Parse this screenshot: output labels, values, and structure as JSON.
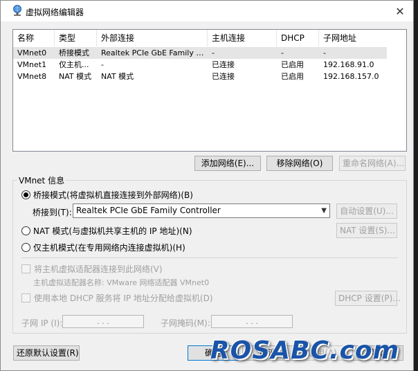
{
  "window": {
    "title": "虚拟网络编辑器",
    "close_glyph": "✕"
  },
  "network_list": {
    "columns": [
      "名称",
      "类型",
      "外部连接",
      "主机连接",
      "DHCP",
      "子网地址"
    ],
    "rows": [
      {
        "name": "VMnet0",
        "type": "桥接模式",
        "external": "Realtek PCIe GbE Family Co...",
        "host": "-",
        "dhcp": "-",
        "subnet": "-",
        "selected": true
      },
      {
        "name": "VMnet1",
        "type": "仅主机...",
        "external": "-",
        "host": "已连接",
        "dhcp": "已启用",
        "subnet": "192.168.91.0",
        "selected": false
      },
      {
        "name": "VMnet8",
        "type": "NAT 模式",
        "external": "NAT 模式",
        "host": "已连接",
        "dhcp": "已启用",
        "subnet": "192.168.157.0",
        "selected": false
      }
    ]
  },
  "list_buttons": {
    "add": "添加网络(E)...",
    "remove": "移除网络(O)",
    "rename": "重命名网络(A)..."
  },
  "vmnet_info": {
    "group_label": "VMnet 信息",
    "bridged_radio": "桥接模式(将虚拟机直接连接到外部网络)(B)",
    "bridged_to_label": "桥接到(T):",
    "bridged_to_value": "Realtek PCIe GbE Family Controller",
    "auto_settings": "自动设置(U)...",
    "nat_radio": "NAT 模式(与虚拟机共享主机的 IP 地址)(N)",
    "nat_settings": "NAT 设置(S)...",
    "hostonly_radio": "仅主机模式(在专用网络内连接虚拟机)(H)",
    "connect_adapter": "将主机虚拟适配器连接到此网络(V)",
    "adapter_name": "主机虚拟适配器名称: VMware 网络适配器 VMnet0",
    "use_dhcp": "使用本地 DHCP 服务将 IP 地址分配给虚拟机(D)",
    "dhcp_settings": "DHCP 设置(P)...",
    "subnet_ip_label": "子网 IP (I):",
    "subnet_mask_label": "子网掩码(M):",
    "ip_dots": ". . ."
  },
  "footer": {
    "restore": "还原默认设置(R)",
    "ok": "确定",
    "cancel": "取消",
    "apply": "应用(A)",
    "help": "帮助"
  },
  "watermark": "ROSABC.com",
  "colors": {
    "dialog_bg": "#f0f0f0",
    "selected_row": "#e5e5e5",
    "disabled_text": "#a0a0a0",
    "watermark_blue": "#1a54a8"
  }
}
